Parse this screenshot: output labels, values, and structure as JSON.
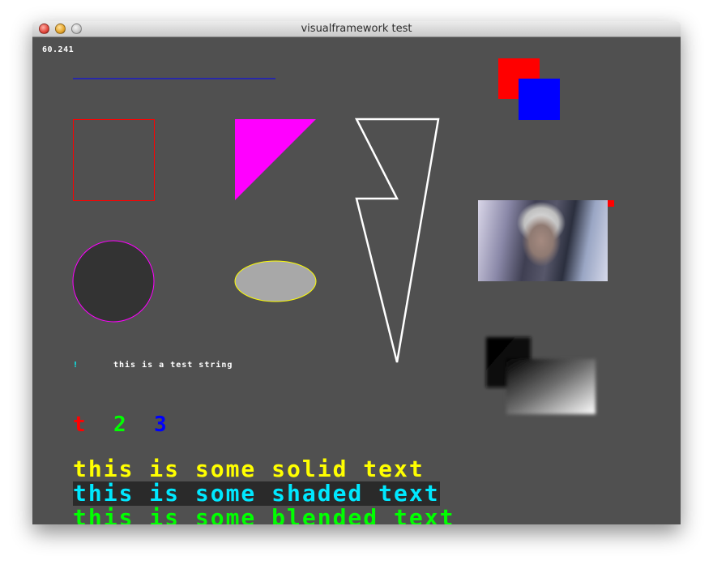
{
  "window": {
    "title": "visualframework test"
  },
  "fps": {
    "value": "60.241"
  },
  "test_string": {
    "glyph": "!",
    "text": "this is a test string"
  },
  "small_glyphs": [
    {
      "text": "t",
      "color": "#ff0000"
    },
    {
      "text": "2",
      "color": "#00ff00"
    },
    {
      "text": "3",
      "color": "#0000ff"
    }
  ],
  "text_lines": {
    "solid": "this is some solid text",
    "shaded": "this is some shaded text",
    "blended": "this is some blended text"
  },
  "colors": {
    "canvas": "#505050",
    "line": "#0000ff",
    "rect_outline": "#ff0000",
    "triangle": "#ff00ff",
    "circle_fill": "#333333",
    "circle_outline": "#ff00ff",
    "ellipse_fill": "#a8a8a8",
    "ellipse_outline": "#ffff00",
    "polygon_outline": "#ffffff",
    "square_red": "#ff0000",
    "square_blue": "#0000ff"
  }
}
